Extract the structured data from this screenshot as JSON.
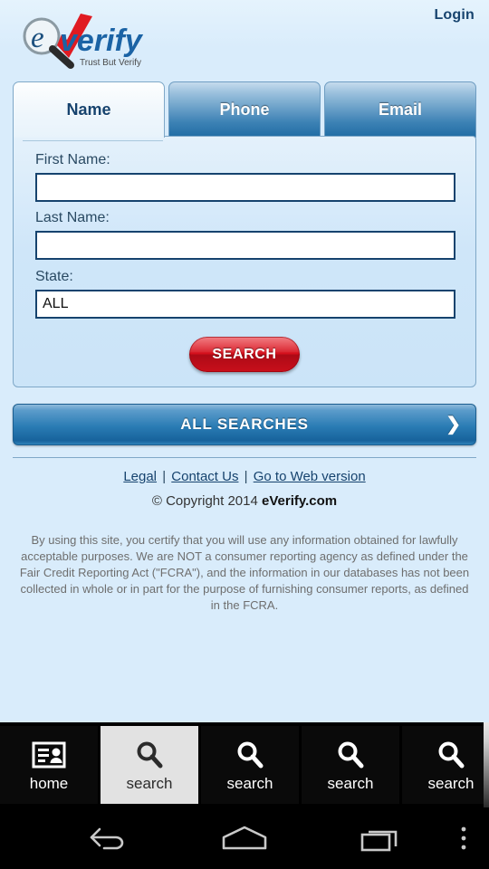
{
  "header": {
    "login_label": "Login",
    "logo": {
      "name": "everify-logo",
      "text_e": "e",
      "text_main": "verify",
      "tagline": "Trust But Verify",
      "icon_search": "magnifier-icon",
      "icon_check": "checkmark-icon"
    }
  },
  "tabs": [
    {
      "label": "Name",
      "name": "tab-name",
      "active": true
    },
    {
      "label": "Phone",
      "name": "tab-phone",
      "active": false
    },
    {
      "label": "Email",
      "name": "tab-email",
      "active": false
    }
  ],
  "form": {
    "first_name": {
      "label": "First Name:",
      "value": "",
      "placeholder": ""
    },
    "last_name": {
      "label": "Last Name:",
      "value": "",
      "placeholder": ""
    },
    "state": {
      "label": "State:",
      "selected": "ALL",
      "options": [
        "ALL"
      ]
    },
    "search_button_label": "SEARCH"
  },
  "all_searches": {
    "label": "ALL SEARCHES",
    "chevron": "chevron-right-icon"
  },
  "footer": {
    "links": [
      {
        "label": "Legal",
        "name": "footer-link-legal"
      },
      {
        "label": "Contact Us",
        "name": "footer-link-contact-us"
      },
      {
        "label": "Go to Web version",
        "name": "footer-link-web-version"
      }
    ],
    "separator": "|",
    "copyright_prefix": "© Copyright 2014 ",
    "copyright_brand": "eVerify.com",
    "disclaimer": "By using this site, you certify that you will use any information obtained for lawfully acceptable purposes. We are NOT a consumer reporting agency as defined under the Fair Credit Reporting Act (\"FCRA\"), and the information in our databases has not been collected in whole or in part for the purpose of furnishing consumer reports, as defined in the FCRA."
  },
  "tabbar": {
    "items": [
      {
        "label": "home",
        "icon": "id-card-icon",
        "name": "tabbar-item-home",
        "selected": false
      },
      {
        "label": "search",
        "icon": "magnifier-icon",
        "name": "tabbar-item-search-1",
        "selected": true
      },
      {
        "label": "search",
        "icon": "magnifier-icon",
        "name": "tabbar-item-search-2",
        "selected": false
      },
      {
        "label": "search",
        "icon": "magnifier-icon",
        "name": "tabbar-item-search-3",
        "selected": false
      },
      {
        "label": "search",
        "icon": "magnifier-icon",
        "name": "tabbar-item-search-4",
        "selected": false
      }
    ]
  },
  "navbar": {
    "back": "back-arrow-icon",
    "home": "home-icon",
    "recents": "recents-icon",
    "menu": "overflow-menu-icon"
  },
  "colors": {
    "page_background": "#d9ecfb",
    "panel_background": "#cfe6f9",
    "accent_blue": "#16436e",
    "tab_blue": "#2a7cb4",
    "search_red": "#d4101c",
    "input_border": "#16436e",
    "navbar_background": "#000000"
  }
}
